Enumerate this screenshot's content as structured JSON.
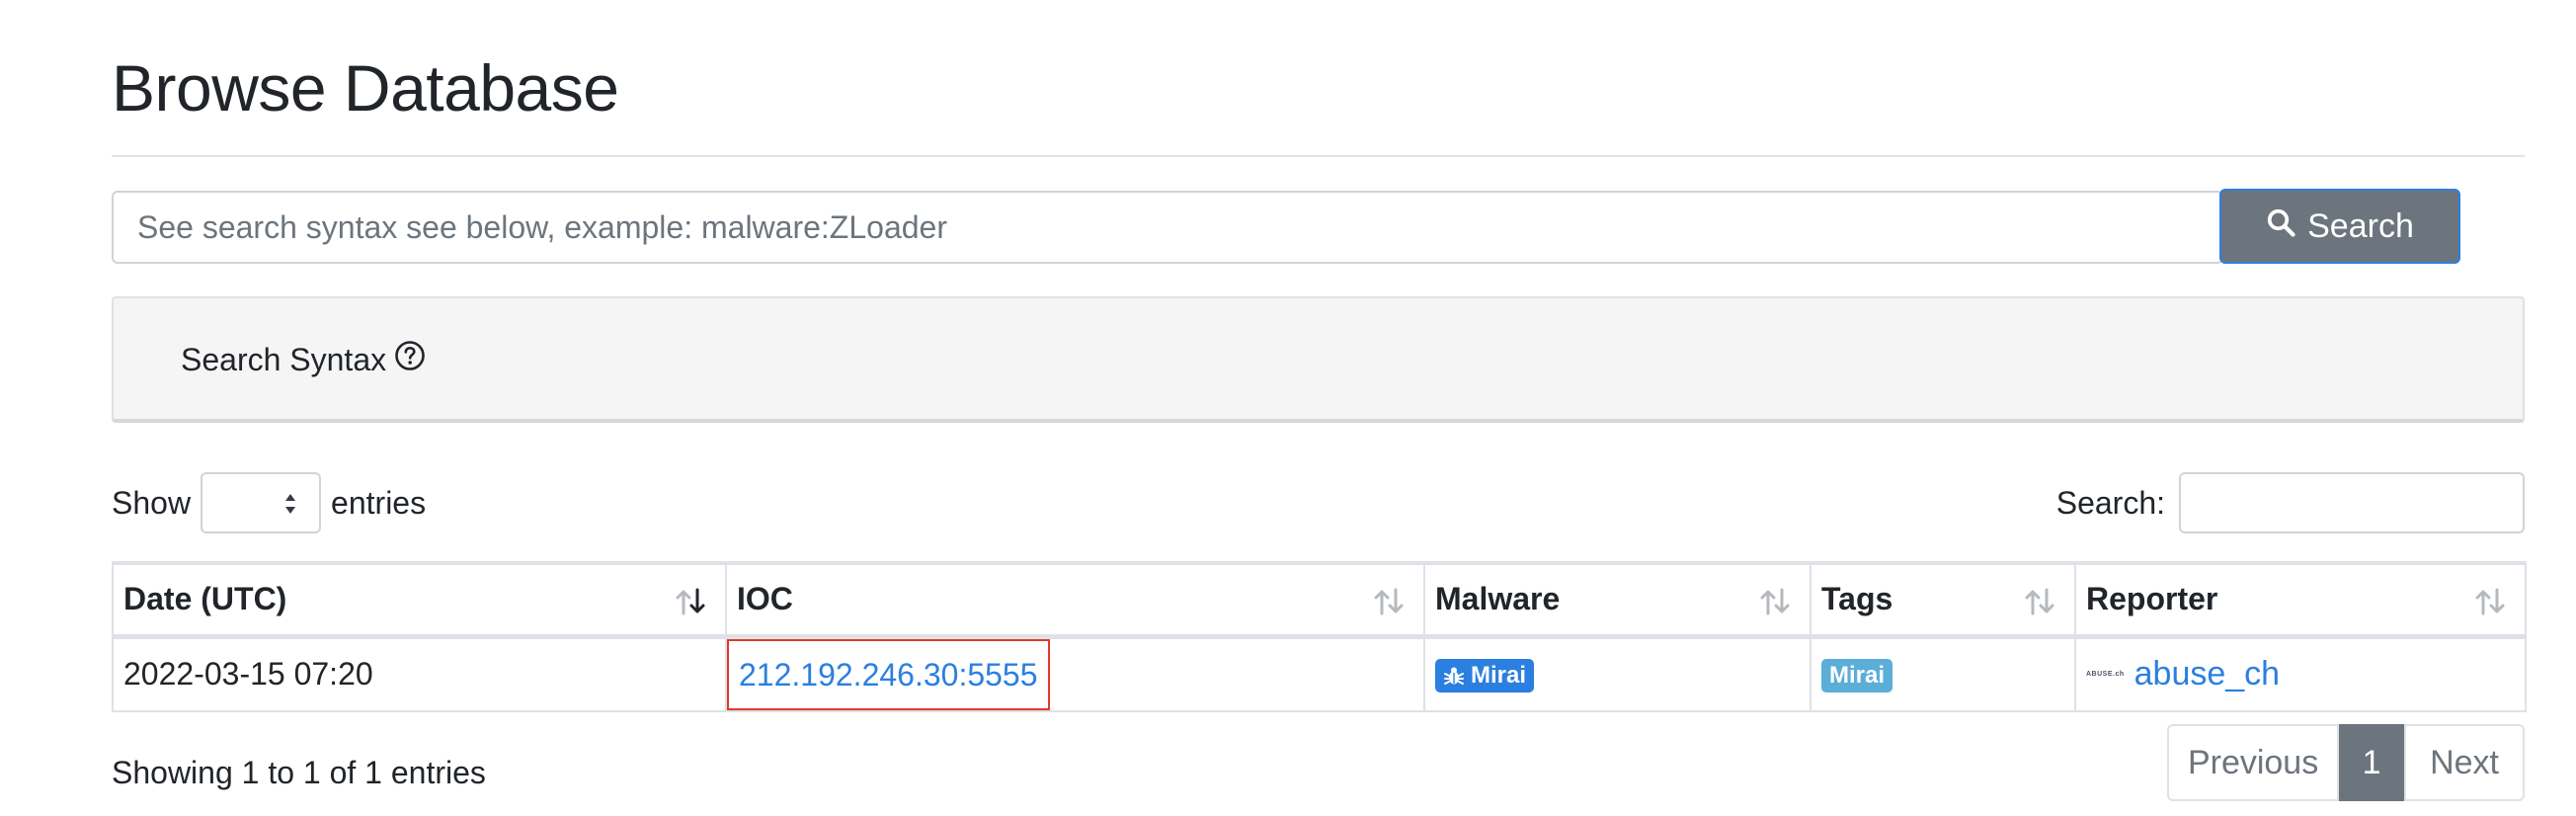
{
  "page": {
    "title": "Browse Database"
  },
  "search": {
    "placeholder": "See search syntax see below, example: malware:ZLoader",
    "button_label": "Search"
  },
  "syntax": {
    "label": "Search Syntax"
  },
  "table_controls": {
    "show_label": "Show",
    "entries_label": "entries",
    "selected_length": "",
    "search_label": "Search:"
  },
  "table": {
    "headers": [
      "Date (UTC)",
      "IOC",
      "Malware",
      "Tags",
      "Reporter"
    ],
    "rows": [
      {
        "date": "2022-03-15 07:20",
        "ioc": "212.192.246.30:5555",
        "malware": "Mirai",
        "tag": "Mirai",
        "reporter_logo": "ABUSE.ch",
        "reporter": "abuse_ch"
      }
    ]
  },
  "footer": {
    "info": "Showing 1 to 1 of 1 entries",
    "previous": "Previous",
    "current_page": "1",
    "next": "Next"
  },
  "colors": {
    "link": "#2b7fe0",
    "button_bg": "#6c757d",
    "highlight_box": "#e0392b",
    "tag_badge": "#5aaed8"
  },
  "icons": {
    "search_button": "search-icon",
    "syntax_help": "question-circle-icon",
    "malware_badge": "bug-icon",
    "sort_active": "sort-descending-icon",
    "sort_inactive": "sort-both-icon"
  }
}
